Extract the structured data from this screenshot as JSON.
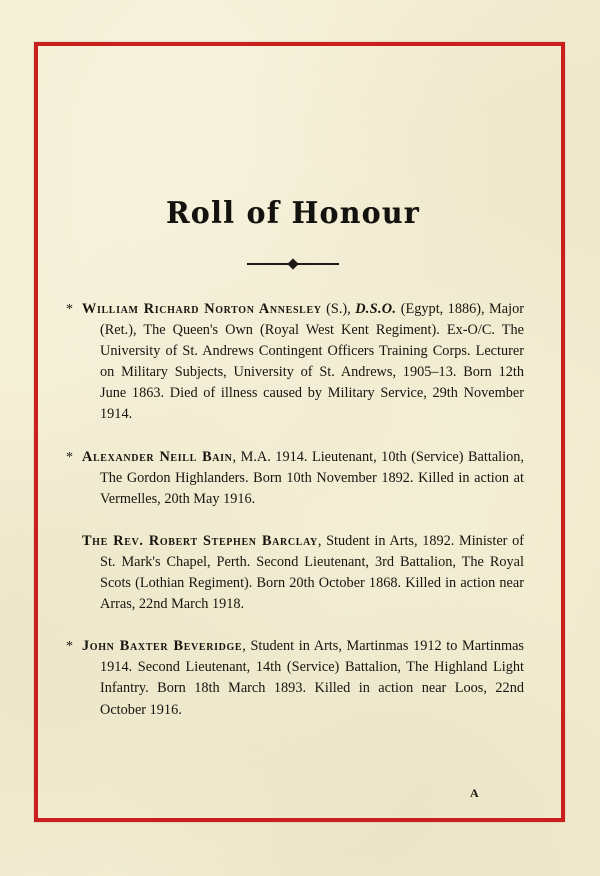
{
  "page": {
    "title": "Roll of Honour",
    "signature_mark": "A",
    "paper_color": "#f4efd6",
    "border_color": "#c8201f",
    "ink_color": "#17150f"
  },
  "ornament": {
    "name": "diamond-rule-divider"
  },
  "entries": [
    {
      "marker": "*",
      "name": "William Richard Norton Annesley",
      "name_suffix": " (S.), ",
      "post_nominal": "D.S.O.",
      "body": " (Egypt, 1886), Major (Ret.), The Queen's Own (Royal West Kent Regiment).   Ex-O/C. The University of St. Andrews Contingent Officers Training Corps. Lecturer on Military Subjects, University of St. Andrews, 1905–13.   Born 12th June 1863.   Died of illness caused by Military Service, 29th November 1914."
    },
    {
      "marker": "*",
      "name": "Alexander Neill Bain",
      "name_suffix": ", ",
      "post_nominal": "",
      "body": "M.A. 1914.   Lieutenant, 10th (Service) Battalion, The Gordon Highlanders.   Born 10th November 1892.   Killed in action at Vermelles, 20th May 1916."
    },
    {
      "marker": "",
      "name": "The Rev. Robert Stephen Barclay",
      "name_suffix": ", ",
      "post_nominal": "",
      "body": "Student in Arts, 1892.   Minister of St. Mark's Chapel, Perth. Second Lieutenant, 3rd Battalion, The Royal Scots (Lothian Regiment).   Born 20th October 1868. Killed in action near Arras, 22nd March 1918."
    },
    {
      "marker": "*",
      "name": "John Baxter Beveridge",
      "name_suffix": ", ",
      "post_nominal": "",
      "body": "Student in Arts, Martinmas 1912 to Martinmas 1914.   Second Lieutenant, 14th (Service) Battalion, The Highland Light Infantry. Born 18th March 1893.   Killed in action near Loos, 22nd October 1916."
    }
  ]
}
